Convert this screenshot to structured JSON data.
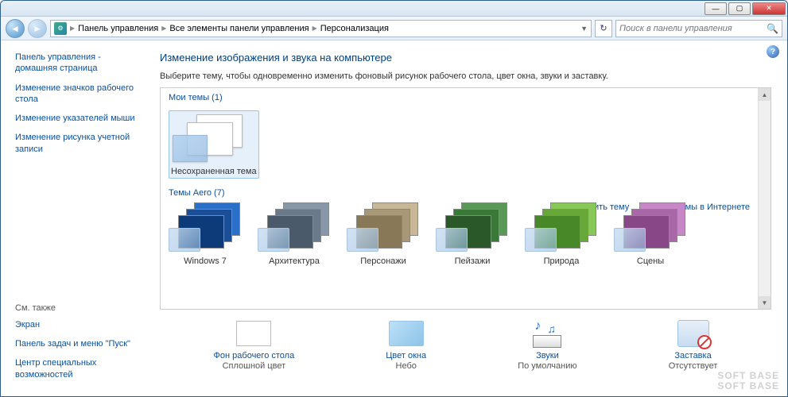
{
  "titlebar": {
    "min": "—",
    "max": "▢",
    "close": "✕"
  },
  "breadcrumb": {
    "seg1": "Панель управления",
    "seg2": "Все элементы панели управления",
    "seg3": "Персонализация"
  },
  "search": {
    "placeholder": "Поиск в панели управления"
  },
  "sidebar": {
    "home": "Панель управления - домашняя страница",
    "icons": "Изменение значков рабочего стола",
    "pointers": "Изменение указателей мыши",
    "account_pic": "Изменение рисунка учетной записи",
    "see_also": "См. также",
    "screen": "Экран",
    "taskbar": "Панель задач и меню \"Пуск\"",
    "ease": "Центр специальных возможностей"
  },
  "main": {
    "title": "Изменение изображения и звука на компьютере",
    "subtitle": "Выберите тему, чтобы одновременно изменить фоновый рисунок рабочего стола, цвет окна, звуки и заставку.",
    "my_themes_label": "Мои темы (1)",
    "unsaved_theme": "Несохраненная тема",
    "save_theme": "Сохранить тему",
    "more_themes": "Другие темы в Интернете",
    "aero_label": "Темы Aero (7)",
    "aero": [
      {
        "label": "Windows 7",
        "colors": [
          "#2a6fc8",
          "#1a4f98",
          "#0d3a78"
        ]
      },
      {
        "label": "Архитектура",
        "colors": [
          "#8898a8",
          "#6a7a8a",
          "#4a5a6a"
        ]
      },
      {
        "label": "Персонажи",
        "colors": [
          "#c8b898",
          "#a89878",
          "#887858"
        ]
      },
      {
        "label": "Пейзажи",
        "colors": [
          "#5a9858",
          "#3a7838",
          "#2a5828"
        ]
      },
      {
        "label": "Природа",
        "colors": [
          "#88c858",
          "#68a838",
          "#488828"
        ]
      },
      {
        "label": "Сцены",
        "colors": [
          "#c888c8",
          "#a868a8",
          "#884888"
        ]
      }
    ]
  },
  "bottom": {
    "bg": {
      "link": "Фон рабочего стола",
      "value": "Сплошной цвет"
    },
    "color": {
      "link": "Цвет окна",
      "value": "Небо"
    },
    "sound": {
      "link": "Звуки",
      "value": "По умолчанию"
    },
    "saver": {
      "link": "Заставка",
      "value": "Отсутствует"
    }
  },
  "watermark": "SOFT   BASE"
}
